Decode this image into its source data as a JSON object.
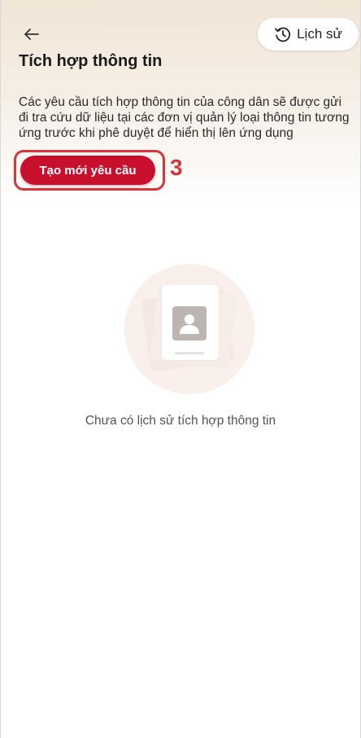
{
  "header": {
    "back_icon": "arrow-left-icon",
    "history_button": {
      "label": "Lịch sử",
      "icon": "history-clock-icon"
    },
    "title": "Tích hợp thông tin"
  },
  "main": {
    "description": "Các yêu cầu tích hợp thông tin của công dân sẽ được gửi đi tra cứu dữ liệu tại các đơn vị quản lý loại thông tin tương ứng trước khi phê duyệt để hiển thị lên ứng dụng",
    "create_button_label": "Tạo mới yêu cầu",
    "step_marker": "3",
    "empty_state": {
      "icon": "user-card-icon",
      "message": "Chưa có lịch sử tích hợp thông tin"
    }
  },
  "colors": {
    "primary": "#c8102e",
    "highlight": "#d9343a",
    "header_gradient_top": "#f1e5d6"
  }
}
